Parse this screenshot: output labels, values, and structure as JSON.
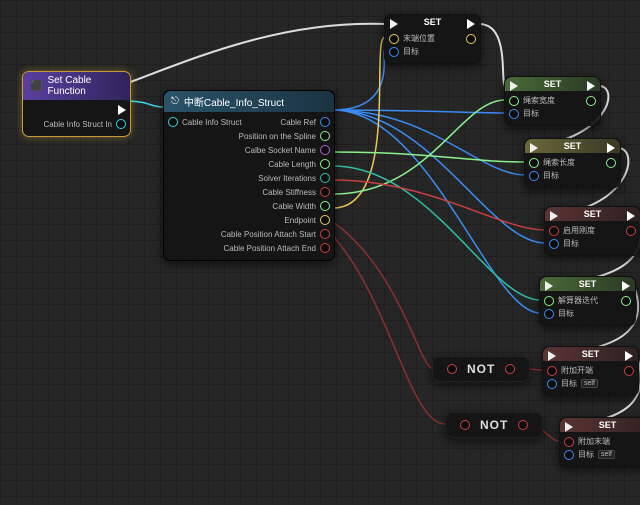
{
  "fn": {
    "title": "Set Cable Function",
    "input": "Cable Info Struct In"
  },
  "break": {
    "title": "中断Cable_Info_Struct",
    "input": "Cable Info Struct",
    "outputs": [
      "Cable Ref",
      "Position on the Spline",
      "Calbe Socket Name",
      "Cable Length",
      "Solver Iterations",
      "Cable Stiffness",
      "Cable Width",
      "Endpoint",
      "Cable Position Attach Start",
      "Cable Position Attach End"
    ]
  },
  "set_label": "SET",
  "target_label": "目标",
  "self_label": "self",
  "sets": [
    {
      "label": "末端位置",
      "color": "#e6c95a",
      "hdr": "#3a3d46"
    },
    {
      "label": "绳索宽度",
      "color": "#8cf28c",
      "hdr": "#3d5a2e"
    },
    {
      "label": "绳索长度",
      "color": "#8cf28c",
      "hdr": "#5a5a2e"
    },
    {
      "label": "启用刚度",
      "color": "#c84040",
      "hdr": "#403030"
    },
    {
      "label": "解算器迭代",
      "color": "#8cf28c",
      "hdr": "#3d5a2e"
    },
    {
      "label": "附加开端",
      "color": "#c84040",
      "hdr": "#403030",
      "self": true
    },
    {
      "label": "附加末端",
      "color": "#c84040",
      "hdr": "#403030",
      "self": true
    }
  ],
  "not_label": "NOT",
  "chart_data": null
}
